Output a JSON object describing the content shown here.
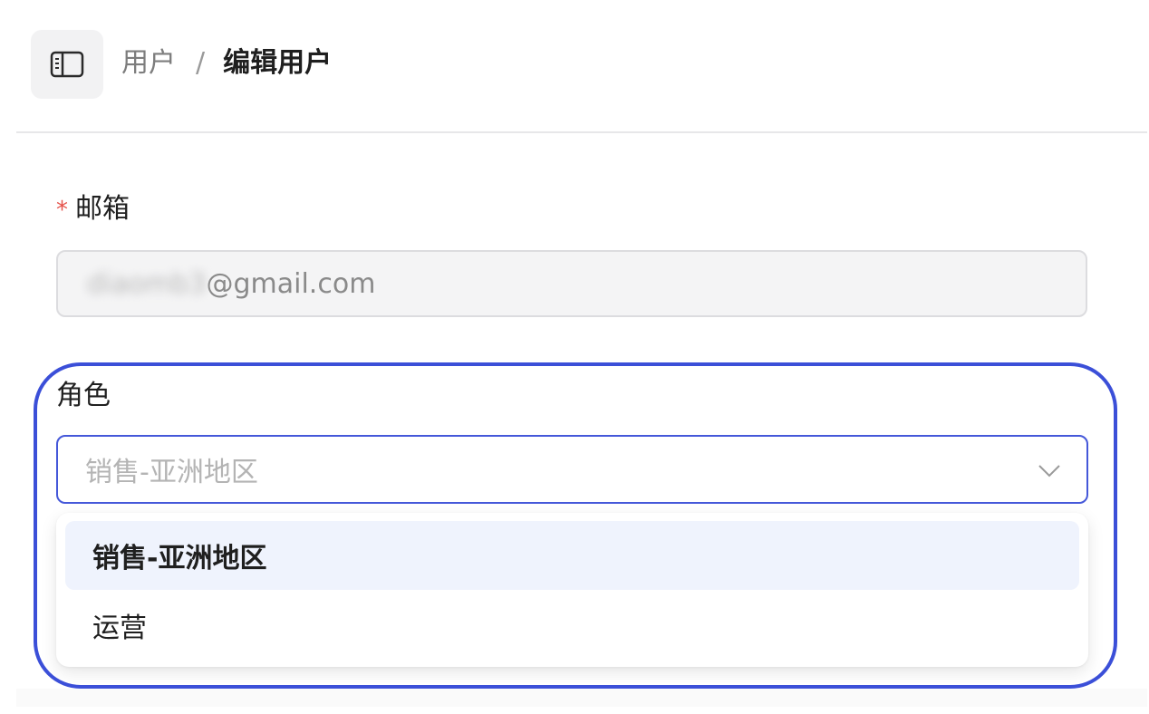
{
  "header": {
    "breadcrumb": {
      "parent": "用户",
      "separator": "/",
      "current": "编辑用户"
    },
    "sidebar_toggle_icon": "sidebar-panel-icon"
  },
  "form": {
    "email": {
      "required_mark": "*",
      "label": "邮箱",
      "value_hidden": "diaomb3",
      "value_domain": "@gmail.com"
    },
    "role": {
      "label": "角色",
      "placeholder": "销售-亚洲地区",
      "chevron_icon": "chevron-down-icon",
      "options": [
        {
          "label": "销售-亚洲地区",
          "selected": true
        },
        {
          "label": "运营",
          "selected": false
        }
      ]
    }
  },
  "colors": {
    "accent": "#3b4fd8",
    "required": "#e5534b",
    "selected_option_bg": "#eff3fd"
  }
}
